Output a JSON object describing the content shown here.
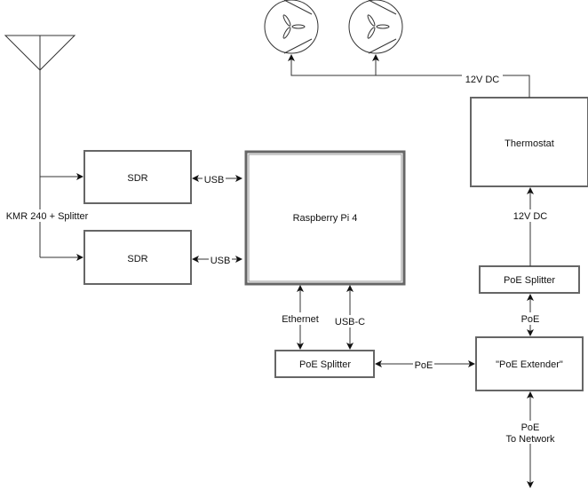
{
  "nodes": {
    "sdr1": "SDR",
    "sdr2": "SDR",
    "pi": "Raspberry Pi 4",
    "thermostat": "Thermostat",
    "poe_splitter_left": "PoE Splitter",
    "poe_splitter_right": "PoE Splitter",
    "poe_extender": "\"PoE Extender\""
  },
  "edges": {
    "cable": "KMR 240 + Splitter",
    "usb1": "USB",
    "usb2": "USB",
    "ethernet": "Ethernet",
    "usbc": "USB-C",
    "poe_mid": "PoE",
    "poe_vertical": "PoE",
    "dc_fans": "12V DC",
    "dc_thermostat": "12V DC",
    "network_line1": "PoE",
    "network_line2": "To Network"
  },
  "icons": [
    "antenna-icon",
    "fan-icon",
    "fan-icon"
  ]
}
